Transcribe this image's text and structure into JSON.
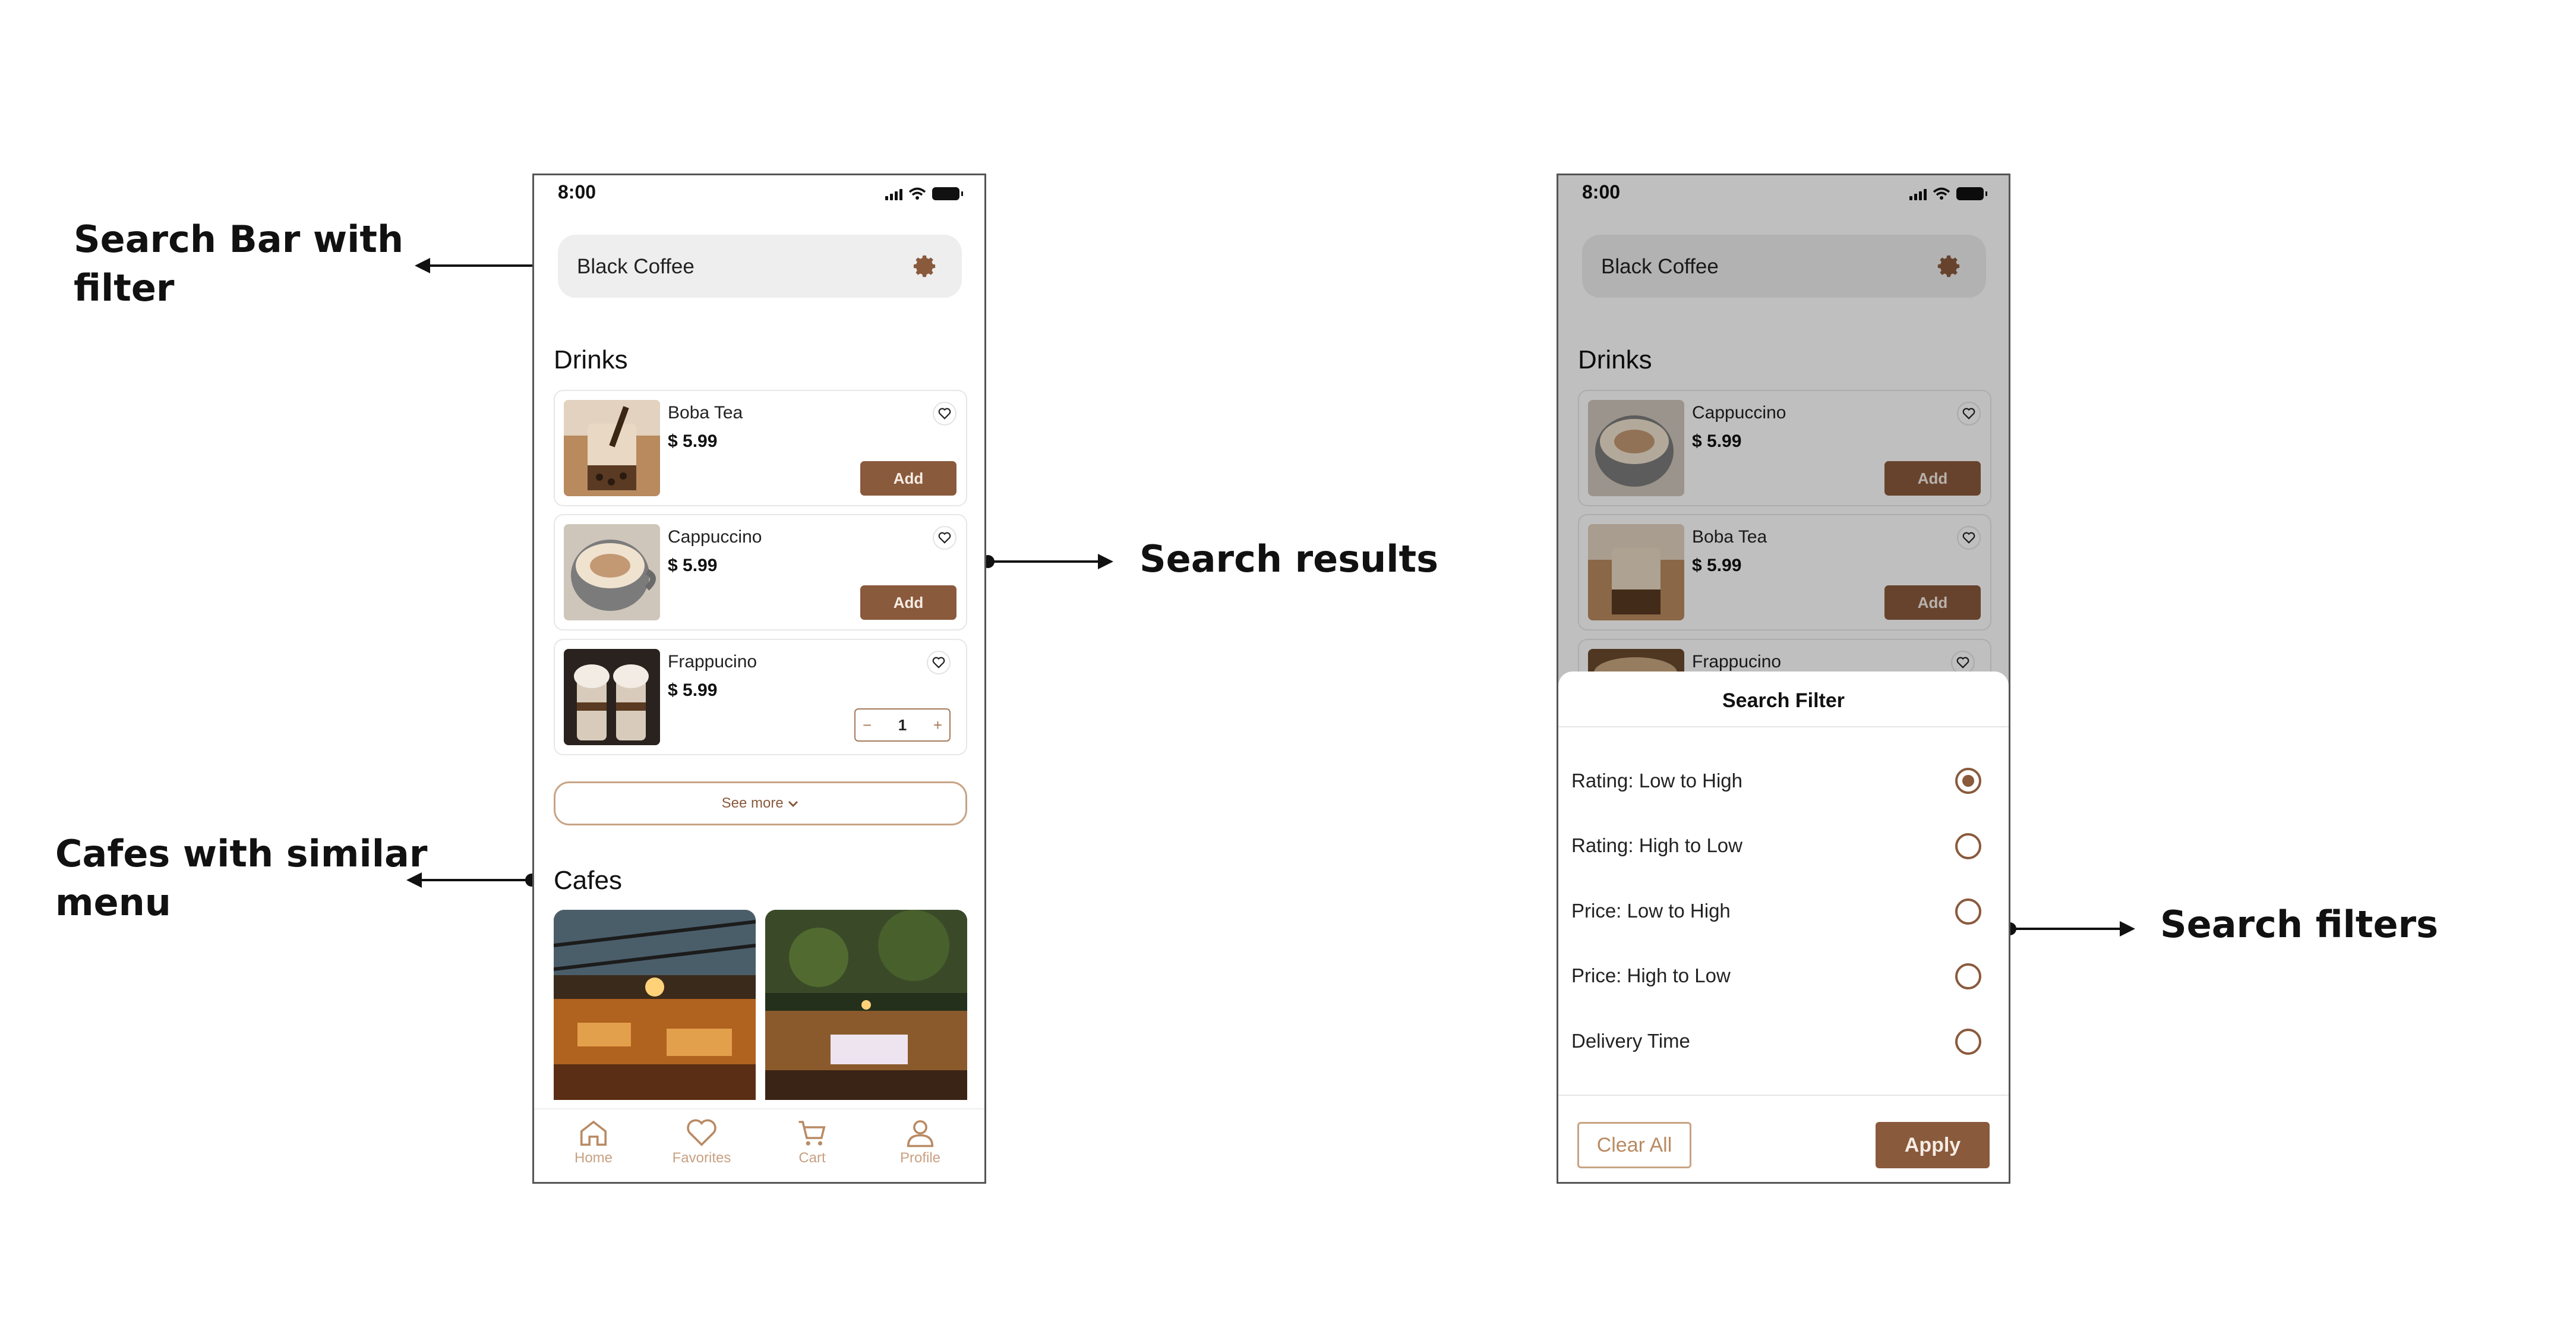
{
  "annotations": {
    "search_bar": "Search Bar with\nfilter",
    "cafes_similar": "Cafes with similar\nmenu",
    "search_results": "Search results",
    "search_filters": "Search filters"
  },
  "status_bar": {
    "time": "8:00"
  },
  "search": {
    "query": "Black Coffee"
  },
  "sections": {
    "drinks": "Drinks",
    "cafes": "Cafes"
  },
  "phone1": {
    "drinks": [
      {
        "name": "Boba Tea",
        "price": "$ 5.99",
        "action": "Add"
      },
      {
        "name": "Cappuccino",
        "price": "$ 5.99",
        "action": "Add"
      },
      {
        "name": "Frappucino",
        "price": "$ 5.99",
        "quantity": "1",
        "minus": "−",
        "plus": "+"
      }
    ],
    "see_more": "See more"
  },
  "phone2": {
    "drinks": [
      {
        "name": "Cappuccino",
        "price": "$ 5.99",
        "action": "Add"
      },
      {
        "name": "Boba Tea",
        "price": "$ 5.99",
        "action": "Add"
      },
      {
        "name": "Frappucino"
      }
    ]
  },
  "filter": {
    "title": "Search Filter",
    "options": [
      "Rating: Low to High",
      "Rating: High to Low",
      "Price: Low to High",
      "Price: High to Low",
      "Delivery Time"
    ],
    "selected_index": 0,
    "clear_label": "Clear All",
    "apply_label": "Apply"
  },
  "tabbar": {
    "home": "Home",
    "favorites": "Favorites",
    "cart": "Cart",
    "profile": "Profile"
  },
  "colors": {
    "accent": "#8a5a3c",
    "accent_light": "#c7a384",
    "overlay": "rgba(0,0,0,0.25)"
  }
}
